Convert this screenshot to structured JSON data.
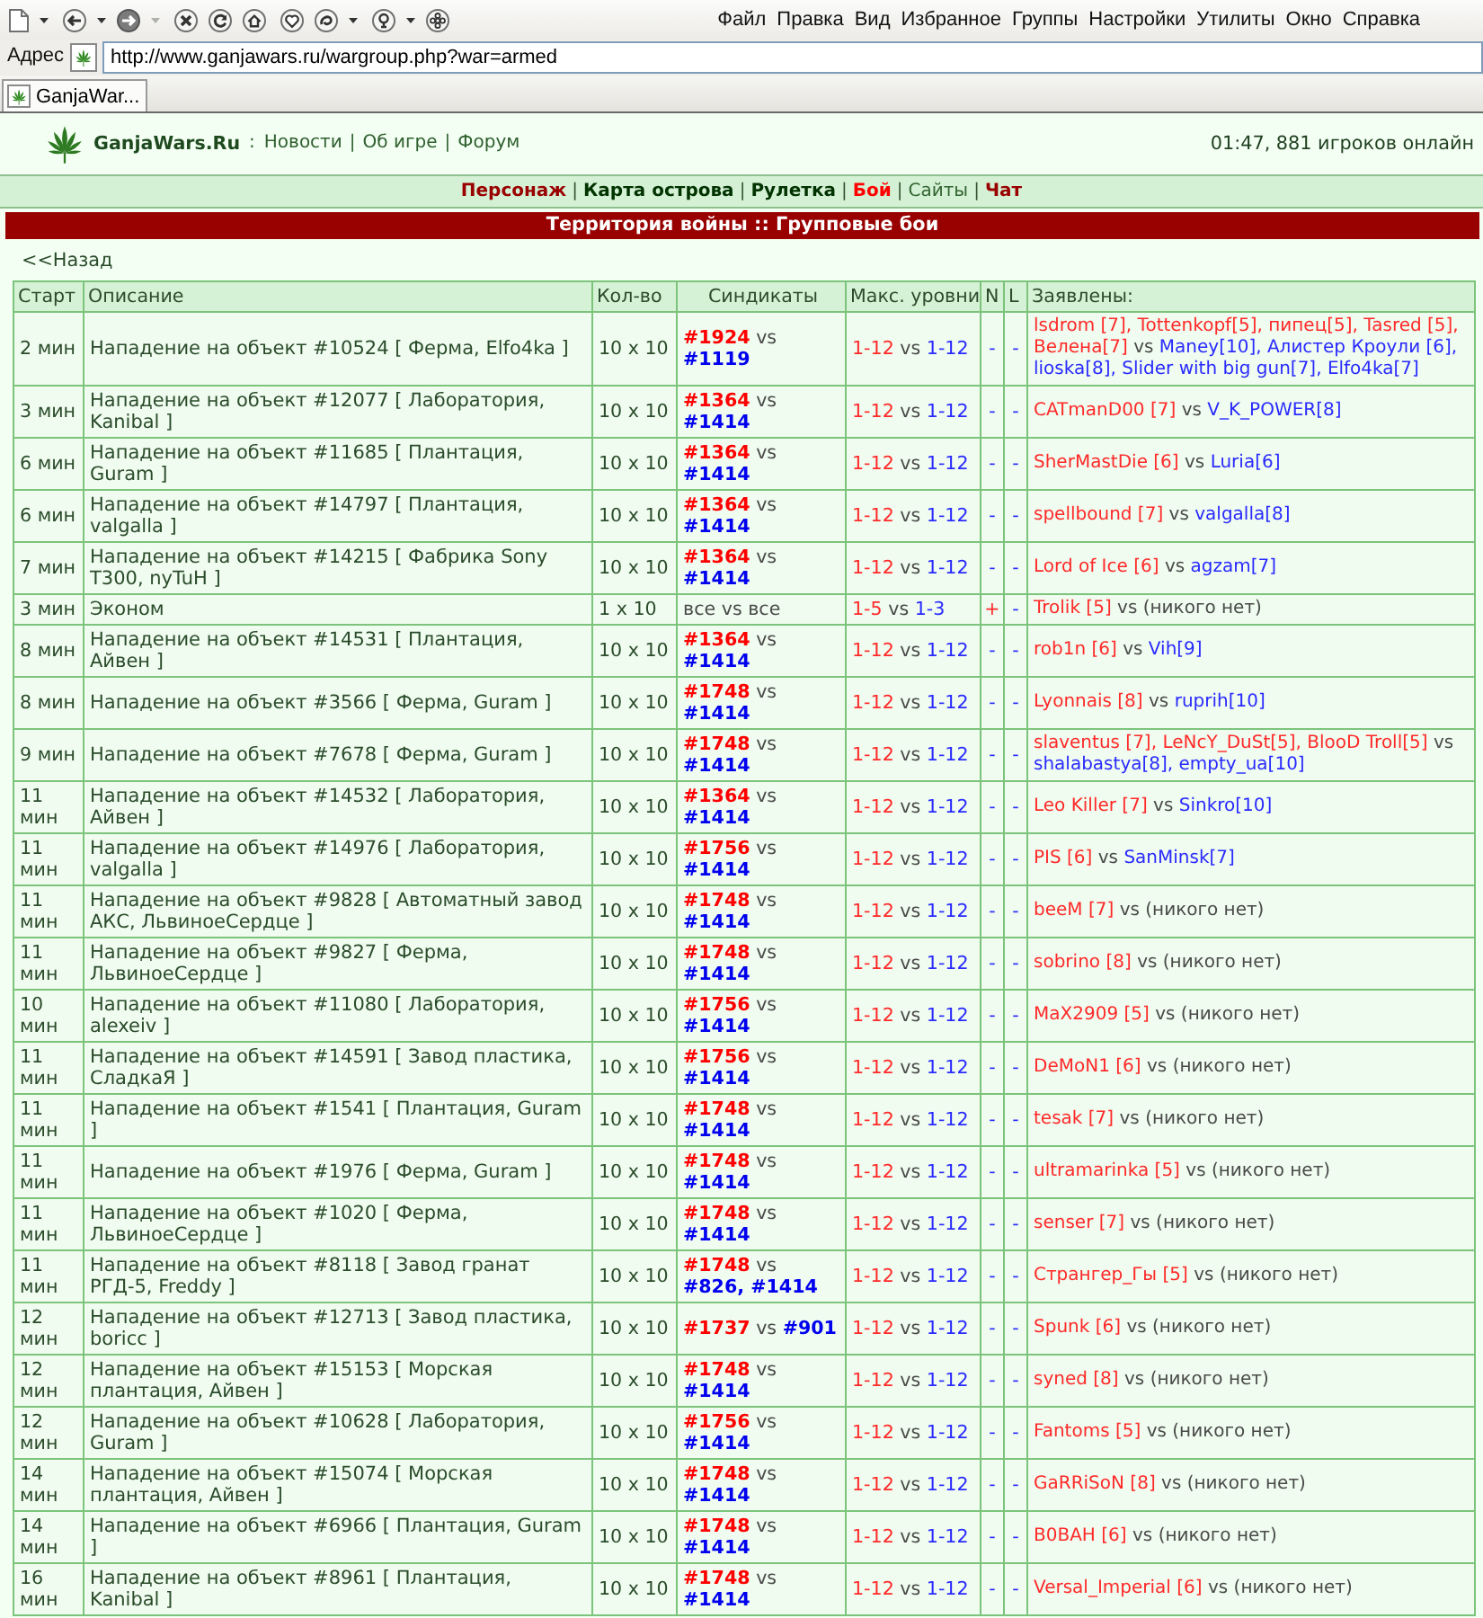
{
  "browser": {
    "toolbar": [
      [
        {
          "kind": "page",
          "disabled": false
        },
        {
          "kind": "caret",
          "disabled": false
        }
      ],
      [
        {
          "kind": "back",
          "disabled": false
        },
        {
          "kind": "caret",
          "disabled": false
        },
        {
          "kind": "forward",
          "disabled": false
        },
        {
          "kind": "caret",
          "disabled": true
        }
      ],
      [
        {
          "kind": "stop",
          "disabled": false
        },
        {
          "kind": "reload",
          "disabled": false
        },
        {
          "kind": "home",
          "disabled": false
        }
      ],
      [
        {
          "kind": "heart",
          "disabled": false
        },
        {
          "kind": "swirl",
          "disabled": false
        },
        {
          "kind": "caret",
          "disabled": false
        }
      ],
      [
        {
          "kind": "bulb",
          "disabled": false
        },
        {
          "kind": "caret",
          "disabled": false
        },
        {
          "kind": "gear",
          "disabled": false
        }
      ]
    ],
    "menu": [
      "Файл",
      "Правка",
      "Вид",
      "Избранное",
      "Группы",
      "Настройки",
      "Утилиты",
      "Окно",
      "Справка"
    ],
    "address": {
      "label": "Адрес",
      "url": "http://www.ganjawars.ru/wargroup.php?war=armed"
    },
    "tabs": [
      {
        "title": "GanjaWar...",
        "selected": true
      }
    ]
  },
  "site_header": {
    "name": "GanjaWars.Ru",
    "name_separator": ":",
    "links": [
      {
        "kind": "link",
        "text": "Новости"
      },
      {
        "kind": "divider",
        "text": "|"
      },
      {
        "kind": "link",
        "text": "Об игре"
      },
      {
        "kind": "divider",
        "text": "|"
      },
      {
        "kind": "link",
        "text": "Форум"
      }
    ],
    "status": "01:47, 881 игроков онлайн"
  },
  "nav": [
    {
      "kind": "section",
      "text": "Персонаж",
      "color": "#990000"
    },
    {
      "kind": "divider",
      "text": "|"
    },
    {
      "kind": "section",
      "text": "Карта острова",
      "color": "#003300"
    },
    {
      "kind": "divider",
      "text": "|"
    },
    {
      "kind": "section",
      "text": "Рулетка",
      "color": "#003300"
    },
    {
      "kind": "divider",
      "text": "|"
    },
    {
      "kind": "section",
      "text": "Бой",
      "color": "#ff0000"
    },
    {
      "kind": "divider",
      "text": "|"
    },
    {
      "kind": "link",
      "text": "Сайты",
      "color": "#336633"
    },
    {
      "kind": "divider",
      "text": "|"
    },
    {
      "kind": "section",
      "text": "Чат",
      "color": "#990000"
    }
  ],
  "section_title": "Территория войны :: Групповые бои",
  "back_link": "<<Назад",
  "table": {
    "columns": [
      "Старт",
      "Описание",
      "Кол-во",
      "Синдикаты",
      "Макс. уровни",
      "N",
      "L",
      "Заявлены:"
    ],
    "rows": [
      {
        "start": "2 мин",
        "description": "Нападение на объект #10524 [ Ферма, Elfo4ka ]",
        "count": "10 x 10",
        "syndicates": {
          "kind": "versus",
          "attackers": "#1924",
          "vs": "vs",
          "defenders": "#1119"
        },
        "levels": {
          "attackers": "1-12",
          "vs": "vs",
          "defenders": "1-12"
        },
        "n": {
          "text": "-",
          "on": false
        },
        "l": {
          "text": "-",
          "on": false
        },
        "applicants": {
          "attackers": "lsdrom [7], Tottenkopf[5], пипец[5], Tasred [5], Велена[7]",
          "vs": "vs",
          "defenders": "Maney[10], Алистер Кроули [6], lioska[8], Slider with big gun[7], Elfo4ka[7]",
          "nobody": false
        }
      },
      {
        "start": "3 мин",
        "description": "Нападение на объект #12077 [ Лаборатория, Kanibal ]",
        "count": "10 x 10",
        "syndicates": {
          "kind": "versus",
          "attackers": "#1364",
          "vs": "vs",
          "defenders": "#1414"
        },
        "levels": {
          "attackers": "1-12",
          "vs": "vs",
          "defenders": "1-12"
        },
        "n": {
          "text": "-",
          "on": false
        },
        "l": {
          "text": "-",
          "on": false
        },
        "applicants": {
          "attackers": "CATmanD00 [7]",
          "vs": "vs",
          "defenders": "V_K_POWER[8]",
          "nobody": false
        }
      },
      {
        "start": "6 мин",
        "description": "Нападение на объект #11685 [ Плантация, Guram ]",
        "count": "10 x 10",
        "syndicates": {
          "kind": "versus",
          "attackers": "#1364",
          "vs": "vs",
          "defenders": "#1414"
        },
        "levels": {
          "attackers": "1-12",
          "vs": "vs",
          "defenders": "1-12"
        },
        "n": {
          "text": "-",
          "on": false
        },
        "l": {
          "text": "-",
          "on": false
        },
        "applicants": {
          "attackers": "SherMastDie [6]",
          "vs": "vs",
          "defenders": "Luria[6]",
          "nobody": false
        }
      },
      {
        "start": "6 мин",
        "description": "Нападение на объект #14797 [ Плантация, valgalla ]",
        "count": "10 x 10",
        "syndicates": {
          "kind": "versus",
          "attackers": "#1364",
          "vs": "vs",
          "defenders": "#1414"
        },
        "levels": {
          "attackers": "1-12",
          "vs": "vs",
          "defenders": "1-12"
        },
        "n": {
          "text": "-",
          "on": false
        },
        "l": {
          "text": "-",
          "on": false
        },
        "applicants": {
          "attackers": "spellbound [7]",
          "vs": "vs",
          "defenders": "valgalla[8]",
          "nobody": false
        }
      },
      {
        "start": "7 мин",
        "description": "Нападение на объект #14215 [ Фабрика Sony T300, nyTuH ]",
        "count": "10 x 10",
        "syndicates": {
          "kind": "versus",
          "attackers": "#1364",
          "vs": "vs",
          "defenders": "#1414"
        },
        "levels": {
          "attackers": "1-12",
          "vs": "vs",
          "defenders": "1-12"
        },
        "n": {
          "text": "-",
          "on": false
        },
        "l": {
          "text": "-",
          "on": false
        },
        "applicants": {
          "attackers": "Lord of Ice [6]",
          "vs": "vs",
          "defenders": "agzam[7]",
          "nobody": false
        }
      },
      {
        "start": "3 мин",
        "description": "Эконом",
        "count": "1 x 10",
        "syndicates": {
          "kind": "open",
          "attackers": "все",
          "vs": "vs",
          "defenders": "все"
        },
        "levels": {
          "attackers": "1-5",
          "vs": "vs",
          "defenders": "1-3"
        },
        "n": {
          "text": "+",
          "on": true
        },
        "l": {
          "text": "-",
          "on": false
        },
        "applicants": {
          "attackers": "Trolik [5]",
          "vs": "vs",
          "defenders": "(никого нет)",
          "nobody": true
        }
      },
      {
        "start": "8 мин",
        "description": "Нападение на объект #14531 [ Плантация, Айвен ]",
        "count": "10 x 10",
        "syndicates": {
          "kind": "versus",
          "attackers": "#1364",
          "vs": "vs",
          "defenders": "#1414"
        },
        "levels": {
          "attackers": "1-12",
          "vs": "vs",
          "defenders": "1-12"
        },
        "n": {
          "text": "-",
          "on": false
        },
        "l": {
          "text": "-",
          "on": false
        },
        "applicants": {
          "attackers": "rob1n [6]",
          "vs": "vs",
          "defenders": "Vih[9]",
          "nobody": false
        }
      },
      {
        "start": "8 мин",
        "description": "Нападение на объект #3566 [ Ферма, Guram ]",
        "count": "10 x 10",
        "syndicates": {
          "kind": "versus",
          "attackers": "#1748",
          "vs": "vs",
          "defenders": "#1414"
        },
        "levels": {
          "attackers": "1-12",
          "vs": "vs",
          "defenders": "1-12"
        },
        "n": {
          "text": "-",
          "on": false
        },
        "l": {
          "text": "-",
          "on": false
        },
        "applicants": {
          "attackers": "Lyonnais [8]",
          "vs": "vs",
          "defenders": "ruprih[10]",
          "nobody": false
        }
      },
      {
        "start": "9 мин",
        "description": "Нападение на объект #7678 [ Ферма, Guram ]",
        "count": "10 x 10",
        "syndicates": {
          "kind": "versus",
          "attackers": "#1748",
          "vs": "vs",
          "defenders": "#1414"
        },
        "levels": {
          "attackers": "1-12",
          "vs": "vs",
          "defenders": "1-12"
        },
        "n": {
          "text": "-",
          "on": false
        },
        "l": {
          "text": "-",
          "on": false
        },
        "applicants": {
          "attackers": "slaventus [7], LeNcY_DuSt[5], BlooD Troll[5]",
          "vs": "vs",
          "defenders": "shalabastya[8], empty_ua[10]",
          "nobody": false
        }
      },
      {
        "start": "11 мин",
        "description": "Нападение на объект #14532 [ Лаборатория, Айвен ]",
        "count": "10 x 10",
        "syndicates": {
          "kind": "versus",
          "attackers": "#1364",
          "vs": "vs",
          "defenders": "#1414"
        },
        "levels": {
          "attackers": "1-12",
          "vs": "vs",
          "defenders": "1-12"
        },
        "n": {
          "text": "-",
          "on": false
        },
        "l": {
          "text": "-",
          "on": false
        },
        "applicants": {
          "attackers": "Leo Killer [7]",
          "vs": "vs",
          "defenders": "Sinkro[10]",
          "nobody": false
        }
      },
      {
        "start": "11 мин",
        "description": "Нападение на объект #14976 [ Лаборатория, valgalla ]",
        "count": "10 x 10",
        "syndicates": {
          "kind": "versus",
          "attackers": "#1756",
          "vs": "vs",
          "defenders": "#1414"
        },
        "levels": {
          "attackers": "1-12",
          "vs": "vs",
          "defenders": "1-12"
        },
        "n": {
          "text": "-",
          "on": false
        },
        "l": {
          "text": "-",
          "on": false
        },
        "applicants": {
          "attackers": "PIS [6]",
          "vs": "vs",
          "defenders": "SanMinsk[7]",
          "nobody": false
        }
      },
      {
        "start": "11 мин",
        "description": "Нападение на объект #9828 [ Автоматный завод АКС, ЛьвиноеСердце ]",
        "count": "10 x 10",
        "syndicates": {
          "kind": "versus",
          "attackers": "#1748",
          "vs": "vs",
          "defenders": "#1414"
        },
        "levels": {
          "attackers": "1-12",
          "vs": "vs",
          "defenders": "1-12"
        },
        "n": {
          "text": "-",
          "on": false
        },
        "l": {
          "text": "-",
          "on": false
        },
        "applicants": {
          "attackers": "beeM [7]",
          "vs": "vs",
          "defenders": "(никого нет)",
          "nobody": true
        }
      },
      {
        "start": "11 мин",
        "description": "Нападение на объект #9827 [ Ферма, ЛьвиноеСердце ]",
        "count": "10 x 10",
        "syndicates": {
          "kind": "versus",
          "attackers": "#1748",
          "vs": "vs",
          "defenders": "#1414"
        },
        "levels": {
          "attackers": "1-12",
          "vs": "vs",
          "defenders": "1-12"
        },
        "n": {
          "text": "-",
          "on": false
        },
        "l": {
          "text": "-",
          "on": false
        },
        "applicants": {
          "attackers": "sobrino [8]",
          "vs": "vs",
          "defenders": "(никого нет)",
          "nobody": true
        }
      },
      {
        "start": "10 мин",
        "description": "Нападение на объект #11080 [ Лаборатория, alexeiv ]",
        "count": "10 x 10",
        "syndicates": {
          "kind": "versus",
          "attackers": "#1756",
          "vs": "vs",
          "defenders": "#1414"
        },
        "levels": {
          "attackers": "1-12",
          "vs": "vs",
          "defenders": "1-12"
        },
        "n": {
          "text": "-",
          "on": false
        },
        "l": {
          "text": "-",
          "on": false
        },
        "applicants": {
          "attackers": "MaX2909 [5]",
          "vs": "vs",
          "defenders": "(никого нет)",
          "nobody": true
        }
      },
      {
        "start": "11 мин",
        "description": "Нападение на объект #14591 [ Завод пластика, СладкаЯ ]",
        "count": "10 x 10",
        "syndicates": {
          "kind": "versus",
          "attackers": "#1756",
          "vs": "vs",
          "defenders": "#1414"
        },
        "levels": {
          "attackers": "1-12",
          "vs": "vs",
          "defenders": "1-12"
        },
        "n": {
          "text": "-",
          "on": false
        },
        "l": {
          "text": "-",
          "on": false
        },
        "applicants": {
          "attackers": "DeMoN1 [6]",
          "vs": "vs",
          "defenders": "(никого нет)",
          "nobody": true
        }
      },
      {
        "start": "11 мин",
        "description": "Нападение на объект #1541 [ Плантация, Guram ]",
        "count": "10 x 10",
        "syndicates": {
          "kind": "versus",
          "attackers": "#1748",
          "vs": "vs",
          "defenders": "#1414"
        },
        "levels": {
          "attackers": "1-12",
          "vs": "vs",
          "defenders": "1-12"
        },
        "n": {
          "text": "-",
          "on": false
        },
        "l": {
          "text": "-",
          "on": false
        },
        "applicants": {
          "attackers": "tesak [7]",
          "vs": "vs",
          "defenders": "(никого нет)",
          "nobody": true
        }
      },
      {
        "start": "11 мин",
        "description": "Нападение на объект #1976 [ Ферма, Guram ]",
        "count": "10 x 10",
        "syndicates": {
          "kind": "versus",
          "attackers": "#1748",
          "vs": "vs",
          "defenders": "#1414"
        },
        "levels": {
          "attackers": "1-12",
          "vs": "vs",
          "defenders": "1-12"
        },
        "n": {
          "text": "-",
          "on": false
        },
        "l": {
          "text": "-",
          "on": false
        },
        "applicants": {
          "attackers": "ultramarinka [5]",
          "vs": "vs",
          "defenders": "(никого нет)",
          "nobody": true
        }
      },
      {
        "start": "11 мин",
        "description": "Нападение на объект #1020 [ Ферма, ЛьвиноеСердце ]",
        "count": "10 x 10",
        "syndicates": {
          "kind": "versus",
          "attackers": "#1748",
          "vs": "vs",
          "defenders": "#1414"
        },
        "levels": {
          "attackers": "1-12",
          "vs": "vs",
          "defenders": "1-12"
        },
        "n": {
          "text": "-",
          "on": false
        },
        "l": {
          "text": "-",
          "on": false
        },
        "applicants": {
          "attackers": "senser [7]",
          "vs": "vs",
          "defenders": "(никого нет)",
          "nobody": true
        }
      },
      {
        "start": "11 мин",
        "description": "Нападение на объект #8118 [ Завод гранат РГД-5, Freddy ]",
        "count": "10 x 10",
        "syndicates": {
          "kind": "versus",
          "attackers": "#1748",
          "vs": "vs",
          "defenders": "#826, #1414"
        },
        "levels": {
          "attackers": "1-12",
          "vs": "vs",
          "defenders": "1-12"
        },
        "n": {
          "text": "-",
          "on": false
        },
        "l": {
          "text": "-",
          "on": false
        },
        "applicants": {
          "attackers": "Странгер_Гы [5]",
          "vs": "vs",
          "defenders": "(никого нет)",
          "nobody": true
        }
      },
      {
        "start": "12 мин",
        "description": "Нападение на объект #12713 [ Завод пластика, boricc ]",
        "count": "10 x 10",
        "syndicates": {
          "kind": "versus",
          "attackers": "#1737",
          "vs": "vs",
          "defenders": "#901"
        },
        "levels": {
          "attackers": "1-12",
          "vs": "vs",
          "defenders": "1-12"
        },
        "n": {
          "text": "-",
          "on": false
        },
        "l": {
          "text": "-",
          "on": false
        },
        "applicants": {
          "attackers": "Spunk [6]",
          "vs": "vs",
          "defenders": "(никого нет)",
          "nobody": true
        }
      },
      {
        "start": "12 мин",
        "description": "Нападение на объект #15153 [ Морская плантация, Айвен ]",
        "count": "10 x 10",
        "syndicates": {
          "kind": "versus",
          "attackers": "#1748",
          "vs": "vs",
          "defenders": "#1414"
        },
        "levels": {
          "attackers": "1-12",
          "vs": "vs",
          "defenders": "1-12"
        },
        "n": {
          "text": "-",
          "on": false
        },
        "l": {
          "text": "-",
          "on": false
        },
        "applicants": {
          "attackers": "syned [8]",
          "vs": "vs",
          "defenders": "(никого нет)",
          "nobody": true
        }
      },
      {
        "start": "12 мин",
        "description": "Нападение на объект #10628 [ Лаборатория, Guram ]",
        "count": "10 x 10",
        "syndicates": {
          "kind": "versus",
          "attackers": "#1756",
          "vs": "vs",
          "defenders": "#1414"
        },
        "levels": {
          "attackers": "1-12",
          "vs": "vs",
          "defenders": "1-12"
        },
        "n": {
          "text": "-",
          "on": false
        },
        "l": {
          "text": "-",
          "on": false
        },
        "applicants": {
          "attackers": "Fantoms [5]",
          "vs": "vs",
          "defenders": "(никого нет)",
          "nobody": true
        }
      },
      {
        "start": "14 мин",
        "description": "Нападение на объект #15074 [ Морская плантация, Айвен ]",
        "count": "10 x 10",
        "syndicates": {
          "kind": "versus",
          "attackers": "#1748",
          "vs": "vs",
          "defenders": "#1414"
        },
        "levels": {
          "attackers": "1-12",
          "vs": "vs",
          "defenders": "1-12"
        },
        "n": {
          "text": "-",
          "on": false
        },
        "l": {
          "text": "-",
          "on": false
        },
        "applicants": {
          "attackers": "GaRRiSoN [8]",
          "vs": "vs",
          "defenders": "(никого нет)",
          "nobody": true
        }
      },
      {
        "start": "14 мин",
        "description": "Нападение на объект #6966 [ Плантация, Guram ]",
        "count": "10 x 10",
        "syndicates": {
          "kind": "versus",
          "attackers": "#1748",
          "vs": "vs",
          "defenders": "#1414"
        },
        "levels": {
          "attackers": "1-12",
          "vs": "vs",
          "defenders": "1-12"
        },
        "n": {
          "text": "-",
          "on": false
        },
        "l": {
          "text": "-",
          "on": false
        },
        "applicants": {
          "attackers": "B0BAH [6]",
          "vs": "vs",
          "defenders": "(никого нет)",
          "nobody": true
        }
      },
      {
        "start": "16 мин",
        "description": "Нападение на объект #8961 [ Плантация, Kanibal ]",
        "count": "10 x 10",
        "syndicates": {
          "kind": "versus",
          "attackers": "#1748",
          "vs": "vs",
          "defenders": "#1414"
        },
        "levels": {
          "attackers": "1-12",
          "vs": "vs",
          "defenders": "1-12"
        },
        "n": {
          "text": "-",
          "on": false
        },
        "l": {
          "text": "-",
          "on": false
        },
        "applicants": {
          "attackers": "Versal_Imperial [6]",
          "vs": "vs",
          "defenders": "(никого нет)",
          "nobody": true
        }
      }
    ]
  }
}
